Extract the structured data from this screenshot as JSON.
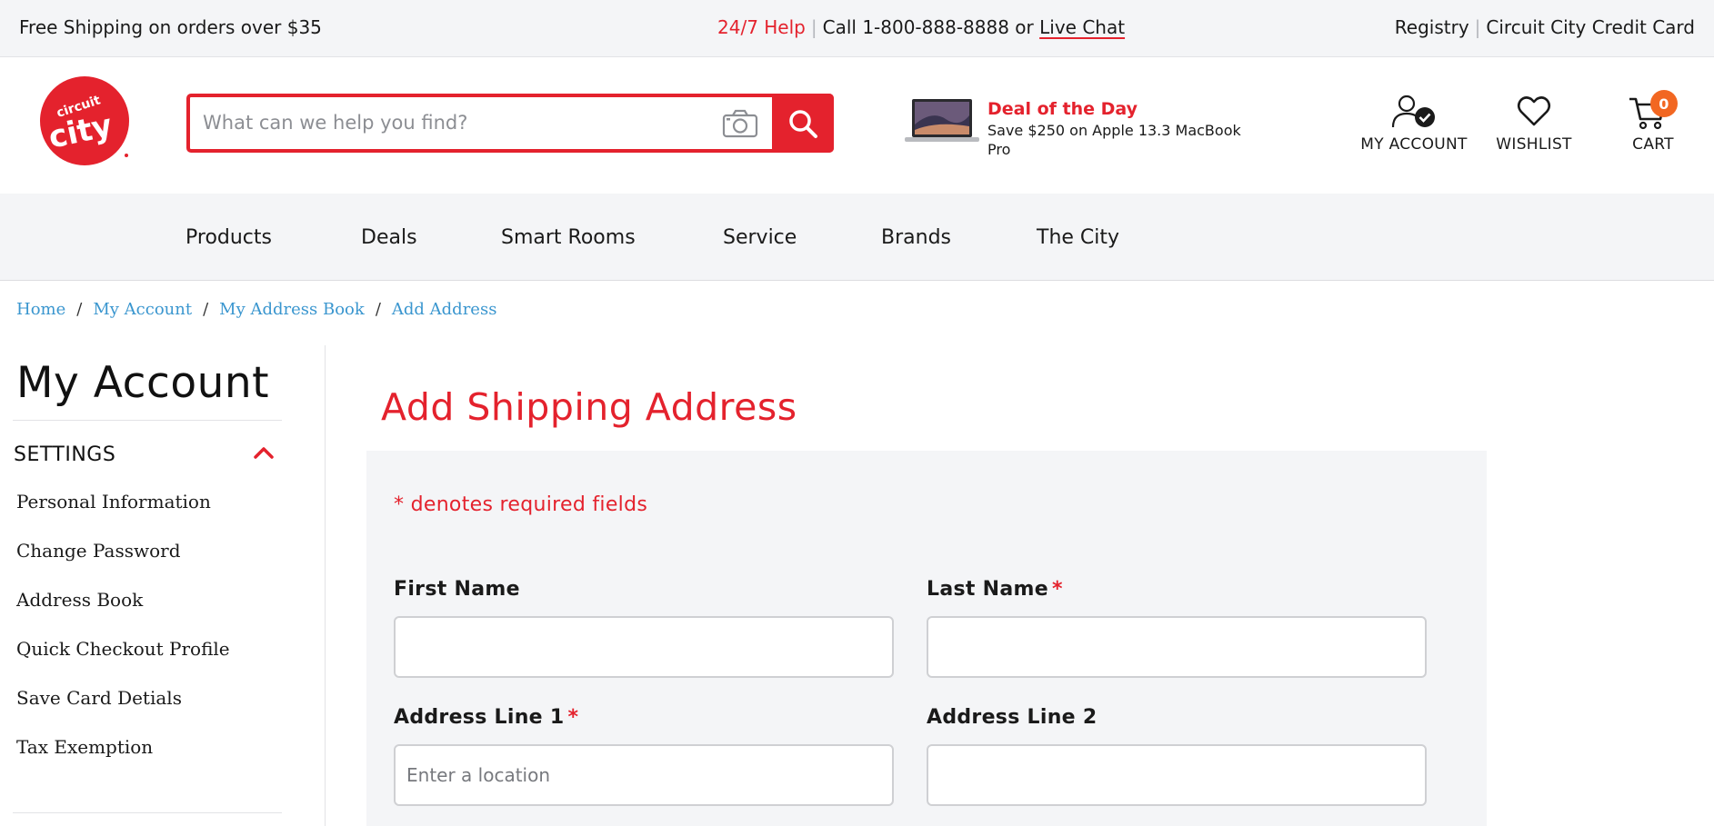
{
  "topbar": {
    "shipping": "Free Shipping on orders over $35",
    "help": "24/7 Help",
    "call": "Call 1-800-888-8888 or",
    "live_chat": "Live Chat",
    "registry": "Registry",
    "credit_card": "Circuit City Credit Card"
  },
  "header": {
    "logo_text": "circuit city",
    "search_placeholder": "What can we help you find?",
    "deal_title": "Deal of the Day",
    "deal_desc": "Save $250 on Apple 13.3 MacBook Pro",
    "my_account": "MY ACCOUNT",
    "wishlist": "WISHLIST",
    "cart": "CART",
    "cart_count": "0"
  },
  "nav": {
    "items": [
      "Products",
      "Deals",
      "Smart Rooms",
      "Service",
      "Brands",
      "The City"
    ]
  },
  "breadcrumb": {
    "items": [
      "Home",
      "My Account",
      "My Address Book",
      "Add Address"
    ]
  },
  "sidebar": {
    "title": "My Account",
    "section": "SETTINGS",
    "links": [
      "Personal Information",
      "Change Password",
      "Address Book",
      "Quick Checkout Profile",
      "Save Card Detials",
      "Tax Exemption"
    ]
  },
  "form": {
    "title": "Add Shipping Address",
    "required_note": "* denotes required fields",
    "first_name_label": "First Name",
    "last_name_label": "Last Name",
    "address1_label": "Address Line 1",
    "address2_label": "Address Line 2",
    "required_star": "*",
    "address1_placeholder": "Enter a location"
  },
  "colors": {
    "brand_red": "#e4222d",
    "link_blue": "#3a96cf",
    "cart_badge": "#f26722",
    "panel_gray": "#f4f5f7"
  },
  "icons": [
    "camera-icon",
    "search-icon",
    "account-icon",
    "heart-icon",
    "cart-icon",
    "chevron-up-icon"
  ]
}
